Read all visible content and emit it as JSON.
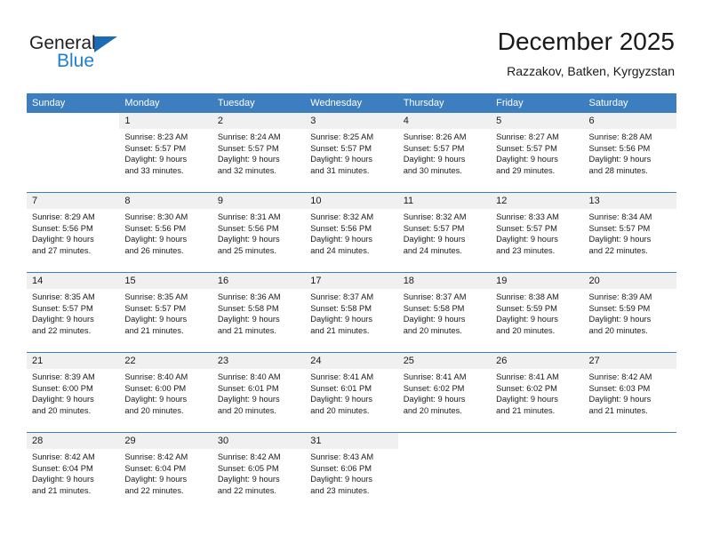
{
  "brand": {
    "line1": "General",
    "line2": "Blue",
    "triangle_color": "#1b6cb5",
    "line2_color": "#1b7fd4"
  },
  "header": {
    "title": "December 2025",
    "subtitle": "Razzakov, Batken, Kyrgyzstan"
  },
  "theme": {
    "header_bg": "#3c7ebf",
    "daynum_bg": "#f0f0f0",
    "text": "#1a1a1a"
  },
  "weekdays": [
    "Sunday",
    "Monday",
    "Tuesday",
    "Wednesday",
    "Thursday",
    "Friday",
    "Saturday"
  ],
  "weeks": [
    [
      {
        "day": "",
        "sunrise": "",
        "sunset": "",
        "daylight1": "",
        "daylight2": ""
      },
      {
        "day": "1",
        "sunrise": "Sunrise: 8:23 AM",
        "sunset": "Sunset: 5:57 PM",
        "daylight1": "Daylight: 9 hours",
        "daylight2": "and 33 minutes."
      },
      {
        "day": "2",
        "sunrise": "Sunrise: 8:24 AM",
        "sunset": "Sunset: 5:57 PM",
        "daylight1": "Daylight: 9 hours",
        "daylight2": "and 32 minutes."
      },
      {
        "day": "3",
        "sunrise": "Sunrise: 8:25 AM",
        "sunset": "Sunset: 5:57 PM",
        "daylight1": "Daylight: 9 hours",
        "daylight2": "and 31 minutes."
      },
      {
        "day": "4",
        "sunrise": "Sunrise: 8:26 AM",
        "sunset": "Sunset: 5:57 PM",
        "daylight1": "Daylight: 9 hours",
        "daylight2": "and 30 minutes."
      },
      {
        "day": "5",
        "sunrise": "Sunrise: 8:27 AM",
        "sunset": "Sunset: 5:57 PM",
        "daylight1": "Daylight: 9 hours",
        "daylight2": "and 29 minutes."
      },
      {
        "day": "6",
        "sunrise": "Sunrise: 8:28 AM",
        "sunset": "Sunset: 5:56 PM",
        "daylight1": "Daylight: 9 hours",
        "daylight2": "and 28 minutes."
      }
    ],
    [
      {
        "day": "7",
        "sunrise": "Sunrise: 8:29 AM",
        "sunset": "Sunset: 5:56 PM",
        "daylight1": "Daylight: 9 hours",
        "daylight2": "and 27 minutes."
      },
      {
        "day": "8",
        "sunrise": "Sunrise: 8:30 AM",
        "sunset": "Sunset: 5:56 PM",
        "daylight1": "Daylight: 9 hours",
        "daylight2": "and 26 minutes."
      },
      {
        "day": "9",
        "sunrise": "Sunrise: 8:31 AM",
        "sunset": "Sunset: 5:56 PM",
        "daylight1": "Daylight: 9 hours",
        "daylight2": "and 25 minutes."
      },
      {
        "day": "10",
        "sunrise": "Sunrise: 8:32 AM",
        "sunset": "Sunset: 5:56 PM",
        "daylight1": "Daylight: 9 hours",
        "daylight2": "and 24 minutes."
      },
      {
        "day": "11",
        "sunrise": "Sunrise: 8:32 AM",
        "sunset": "Sunset: 5:57 PM",
        "daylight1": "Daylight: 9 hours",
        "daylight2": "and 24 minutes."
      },
      {
        "day": "12",
        "sunrise": "Sunrise: 8:33 AM",
        "sunset": "Sunset: 5:57 PM",
        "daylight1": "Daylight: 9 hours",
        "daylight2": "and 23 minutes."
      },
      {
        "day": "13",
        "sunrise": "Sunrise: 8:34 AM",
        "sunset": "Sunset: 5:57 PM",
        "daylight1": "Daylight: 9 hours",
        "daylight2": "and 22 minutes."
      }
    ],
    [
      {
        "day": "14",
        "sunrise": "Sunrise: 8:35 AM",
        "sunset": "Sunset: 5:57 PM",
        "daylight1": "Daylight: 9 hours",
        "daylight2": "and 22 minutes."
      },
      {
        "day": "15",
        "sunrise": "Sunrise: 8:35 AM",
        "sunset": "Sunset: 5:57 PM",
        "daylight1": "Daylight: 9 hours",
        "daylight2": "and 21 minutes."
      },
      {
        "day": "16",
        "sunrise": "Sunrise: 8:36 AM",
        "sunset": "Sunset: 5:58 PM",
        "daylight1": "Daylight: 9 hours",
        "daylight2": "and 21 minutes."
      },
      {
        "day": "17",
        "sunrise": "Sunrise: 8:37 AM",
        "sunset": "Sunset: 5:58 PM",
        "daylight1": "Daylight: 9 hours",
        "daylight2": "and 21 minutes."
      },
      {
        "day": "18",
        "sunrise": "Sunrise: 8:37 AM",
        "sunset": "Sunset: 5:58 PM",
        "daylight1": "Daylight: 9 hours",
        "daylight2": "and 20 minutes."
      },
      {
        "day": "19",
        "sunrise": "Sunrise: 8:38 AM",
        "sunset": "Sunset: 5:59 PM",
        "daylight1": "Daylight: 9 hours",
        "daylight2": "and 20 minutes."
      },
      {
        "day": "20",
        "sunrise": "Sunrise: 8:39 AM",
        "sunset": "Sunset: 5:59 PM",
        "daylight1": "Daylight: 9 hours",
        "daylight2": "and 20 minutes."
      }
    ],
    [
      {
        "day": "21",
        "sunrise": "Sunrise: 8:39 AM",
        "sunset": "Sunset: 6:00 PM",
        "daylight1": "Daylight: 9 hours",
        "daylight2": "and 20 minutes."
      },
      {
        "day": "22",
        "sunrise": "Sunrise: 8:40 AM",
        "sunset": "Sunset: 6:00 PM",
        "daylight1": "Daylight: 9 hours",
        "daylight2": "and 20 minutes."
      },
      {
        "day": "23",
        "sunrise": "Sunrise: 8:40 AM",
        "sunset": "Sunset: 6:01 PM",
        "daylight1": "Daylight: 9 hours",
        "daylight2": "and 20 minutes."
      },
      {
        "day": "24",
        "sunrise": "Sunrise: 8:41 AM",
        "sunset": "Sunset: 6:01 PM",
        "daylight1": "Daylight: 9 hours",
        "daylight2": "and 20 minutes."
      },
      {
        "day": "25",
        "sunrise": "Sunrise: 8:41 AM",
        "sunset": "Sunset: 6:02 PM",
        "daylight1": "Daylight: 9 hours",
        "daylight2": "and 20 minutes."
      },
      {
        "day": "26",
        "sunrise": "Sunrise: 8:41 AM",
        "sunset": "Sunset: 6:02 PM",
        "daylight1": "Daylight: 9 hours",
        "daylight2": "and 21 minutes."
      },
      {
        "day": "27",
        "sunrise": "Sunrise: 8:42 AM",
        "sunset": "Sunset: 6:03 PM",
        "daylight1": "Daylight: 9 hours",
        "daylight2": "and 21 minutes."
      }
    ],
    [
      {
        "day": "28",
        "sunrise": "Sunrise: 8:42 AM",
        "sunset": "Sunset: 6:04 PM",
        "daylight1": "Daylight: 9 hours",
        "daylight2": "and 21 minutes."
      },
      {
        "day": "29",
        "sunrise": "Sunrise: 8:42 AM",
        "sunset": "Sunset: 6:04 PM",
        "daylight1": "Daylight: 9 hours",
        "daylight2": "and 22 minutes."
      },
      {
        "day": "30",
        "sunrise": "Sunrise: 8:42 AM",
        "sunset": "Sunset: 6:05 PM",
        "daylight1": "Daylight: 9 hours",
        "daylight2": "and 22 minutes."
      },
      {
        "day": "31",
        "sunrise": "Sunrise: 8:43 AM",
        "sunset": "Sunset: 6:06 PM",
        "daylight1": "Daylight: 9 hours",
        "daylight2": "and 23 minutes."
      },
      {
        "day": "",
        "sunrise": "",
        "sunset": "",
        "daylight1": "",
        "daylight2": ""
      },
      {
        "day": "",
        "sunrise": "",
        "sunset": "",
        "daylight1": "",
        "daylight2": ""
      },
      {
        "day": "",
        "sunrise": "",
        "sunset": "",
        "daylight1": "",
        "daylight2": ""
      }
    ]
  ]
}
